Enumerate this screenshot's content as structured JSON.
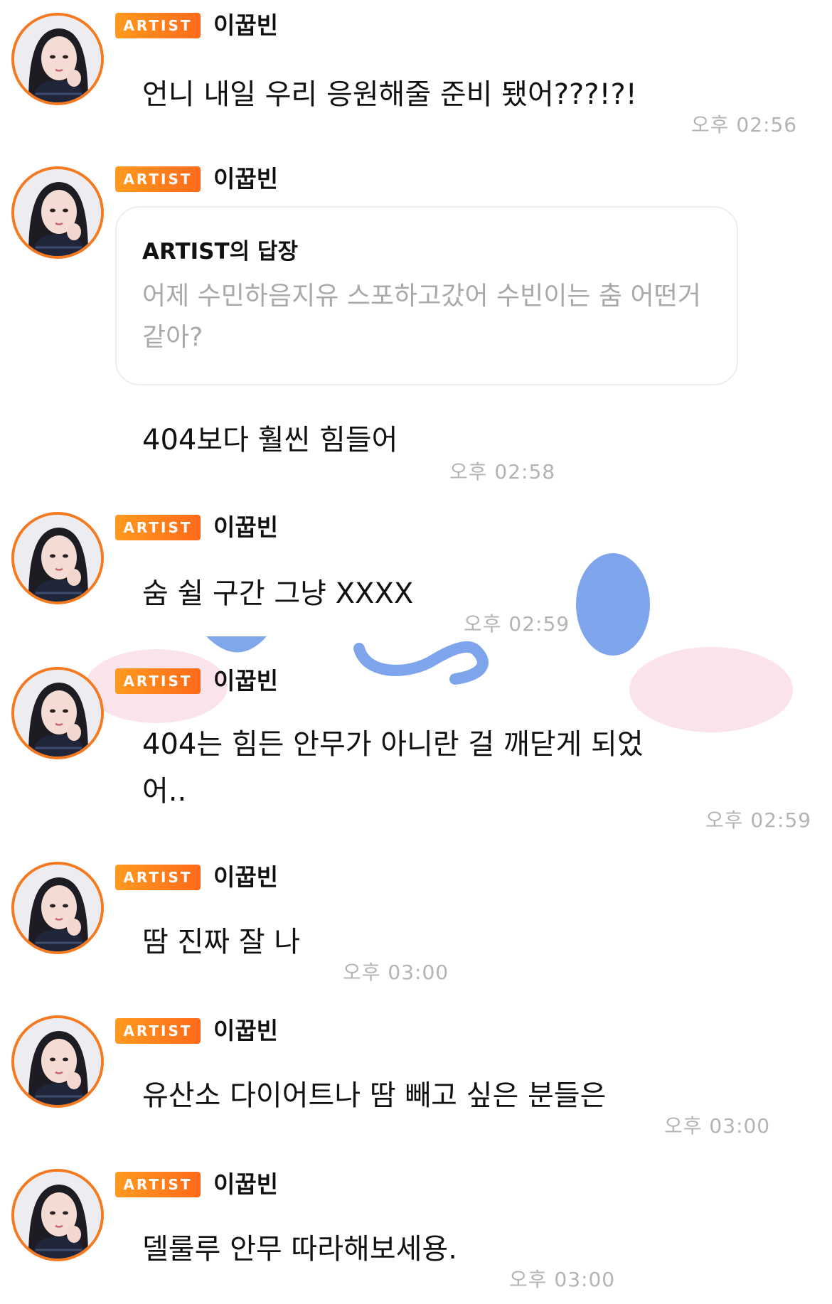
{
  "colors": {
    "accent": "#f4791f",
    "timestamp": "#b4b4b4",
    "reply_text": "#a9a9a9"
  },
  "badge_label": "ARTIST",
  "author_name": "이꿉빈",
  "reply": {
    "title": "ARTIST의 답장",
    "body": "어제 수민하음지유 스포하고갔어 수빈이는 춤 어떤거 같아?"
  },
  "messages": [
    {
      "text": "언니 내일 우리 응원해줄 준비 됐어???!?!",
      "time": "오후 02:56"
    },
    {
      "text": "404보다 훨씬 힘들어",
      "time": "오후 02:58"
    },
    {
      "text": "숨 쉴 구간 그냥 XXXX",
      "time": "오후 02:59"
    },
    {
      "text": "404는 힘든 안무가 아니란 걸 깨닫게 되었어..",
      "time": "오후 02:59"
    },
    {
      "text": "땀 진짜 잘 나",
      "time": "오후 03:00"
    },
    {
      "text": "유산소 다이어트나 땀 빼고 싶은 분들은",
      "time": "오후 03:00"
    },
    {
      "text": "델룰루 안무 따라해보세용.",
      "time": "오후 03:00"
    }
  ]
}
